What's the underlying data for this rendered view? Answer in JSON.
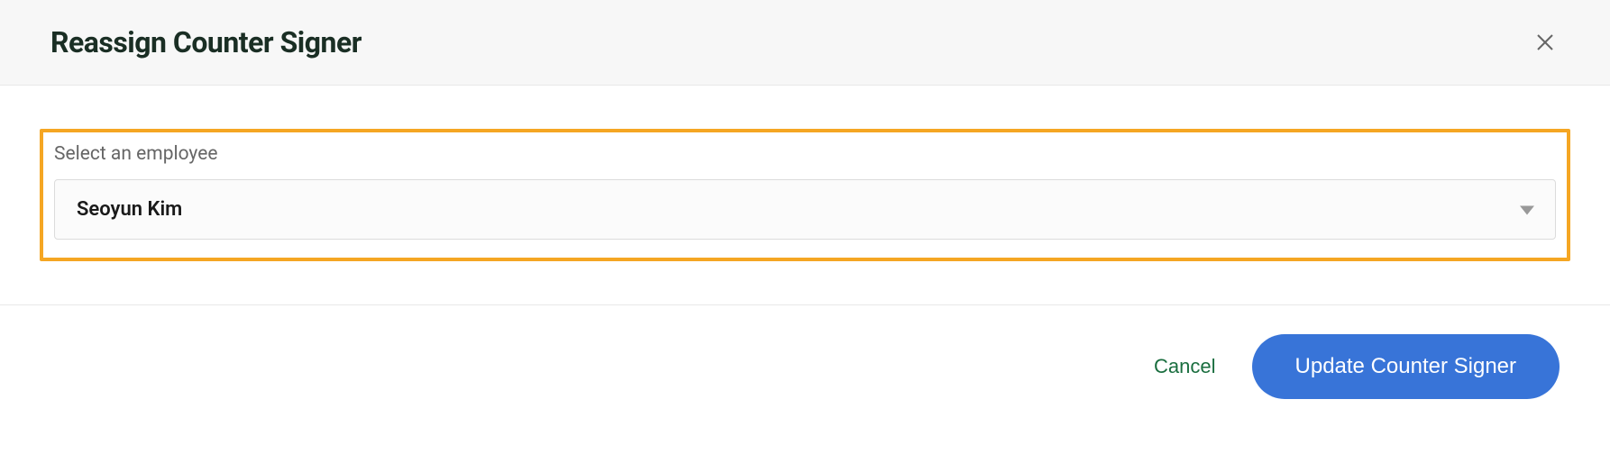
{
  "header": {
    "title": "Reassign Counter Signer"
  },
  "form": {
    "employee_label": "Select an employee",
    "employee_value": "Seoyun Kim"
  },
  "footer": {
    "cancel_label": "Cancel",
    "submit_label": "Update Counter Signer"
  }
}
